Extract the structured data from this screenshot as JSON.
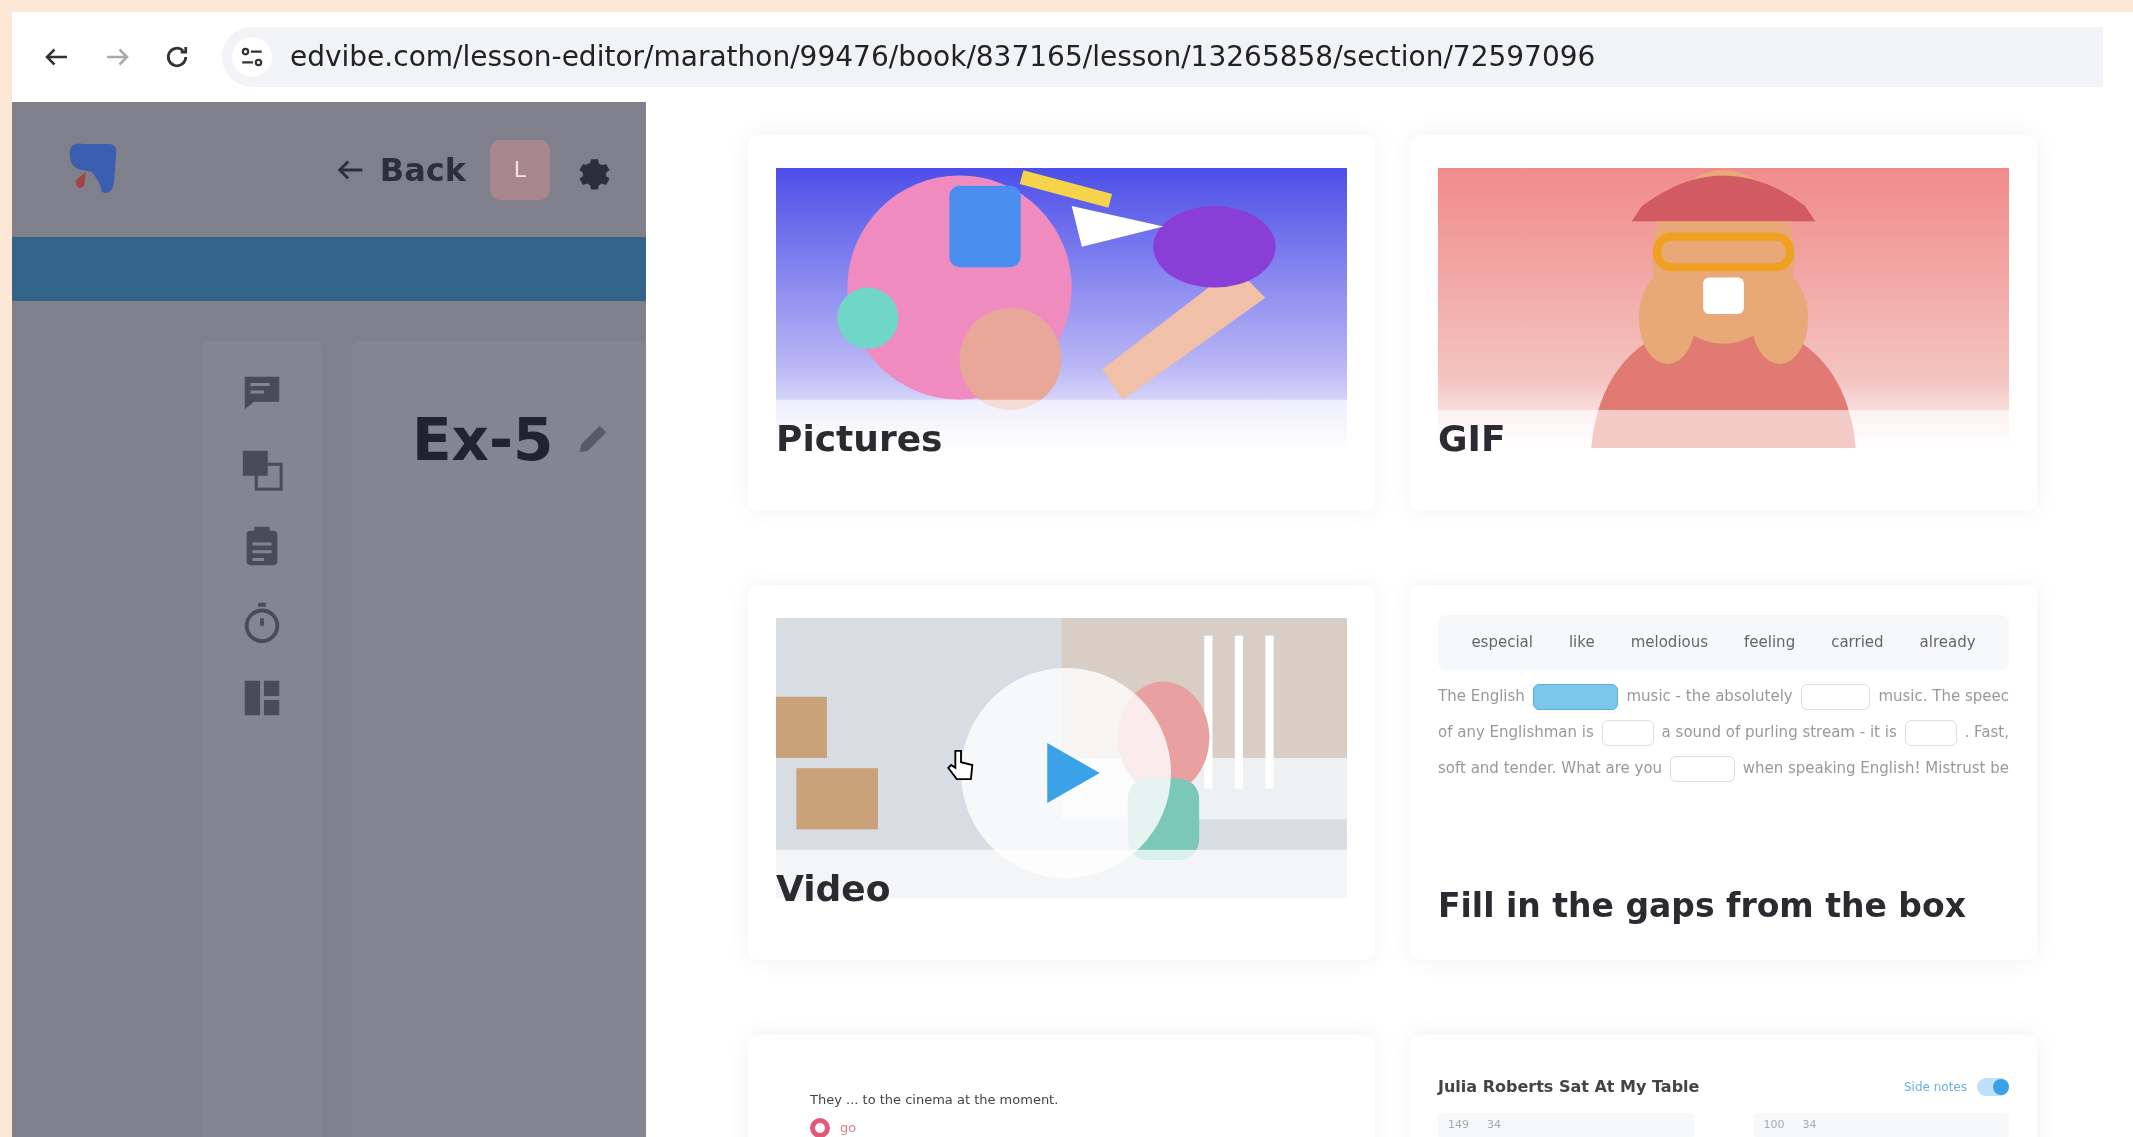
{
  "browser": {
    "url": "edvibe.com/lesson-editor/marathon/99476/book/837165/lesson/13265858/section/72597096",
    "forward_disabled": true
  },
  "app": {
    "back_label": "Back",
    "avatar": "L",
    "title": "Ex-5",
    "tools": [
      {
        "kind": "chat"
      },
      {
        "kind": "translate"
      },
      {
        "kind": "clipboard"
      },
      {
        "kind": "timer"
      },
      {
        "kind": "layout"
      }
    ]
  },
  "cards": [
    {
      "kind": "pictures",
      "title": "Pictures"
    },
    {
      "kind": "gif",
      "title": "GIF"
    },
    {
      "kind": "video",
      "title": "Video"
    },
    {
      "kind": "gaps",
      "title": "Fill in the gaps from the box",
      "words": [
        "especial",
        "like",
        "melodious",
        "feeling",
        "carried",
        "already"
      ],
      "lines": [
        [
          {
            "kind": "text",
            "text": "The English"
          },
          {
            "kind": "blank",
            "filled": true
          },
          {
            "kind": "text",
            "text": "music - the absolutely"
          },
          {
            "kind": "blank",
            "filled": false
          },
          {
            "kind": "text",
            "text": "music. The speec"
          }
        ],
        [
          {
            "kind": "text",
            "text": "of any Englishman is"
          },
          {
            "kind": "blank",
            "filled": false
          },
          {
            "kind": "text",
            "text": "a sound of purling stream - it is"
          },
          {
            "kind": "blank",
            "filled": false
          },
          {
            "kind": "text",
            "text": ". Fast,"
          }
        ],
        [
          {
            "kind": "text",
            "text": "soft and tender. What are you"
          },
          {
            "kind": "blank",
            "filled": false
          },
          {
            "kind": "text",
            "text": "when speaking English! Mistrust be"
          }
        ]
      ]
    },
    {
      "kind": "sentence",
      "sentence": "They ... to the cinema at the moment.",
      "options": [
        {
          "label": "go",
          "selected": true
        }
      ]
    },
    {
      "kind": "text",
      "title": "Julia Roberts Sat At My Table",
      "toggle": {
        "label": "Side notes",
        "on": true
      },
      "counts": [
        {
          "characters": "149",
          "words": "34"
        },
        {
          "characters": "100",
          "words": "34"
        }
      ]
    }
  ]
}
